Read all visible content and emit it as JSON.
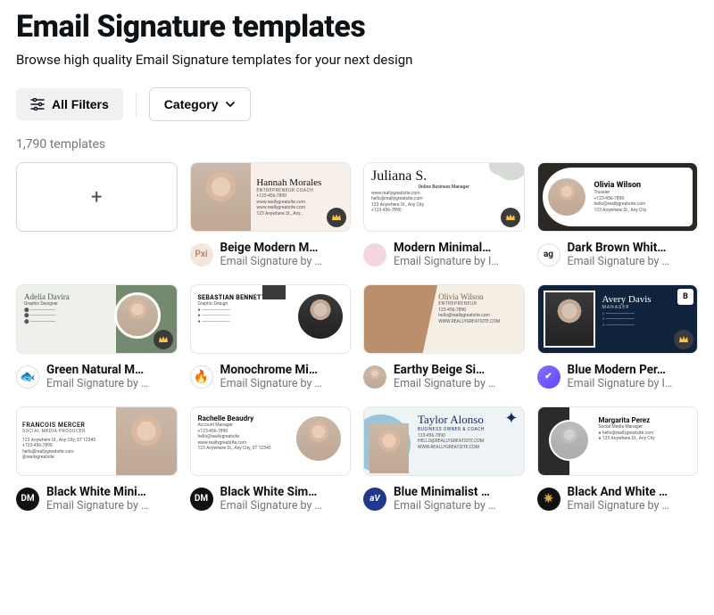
{
  "header": {
    "title": "Email Signature templates",
    "subtitle": "Browse high quality Email Signature templates for your next design"
  },
  "filters": {
    "all_label": "All Filters",
    "category_label": "Category"
  },
  "count_text": "1,790 templates",
  "create_blank_symbol": "+",
  "templates": [
    {
      "title": "Beige Modern M…",
      "author_line": "Email Signature by …",
      "avatar_bg": "#f4e6dc",
      "avatar_text": "Pxi",
      "avatar_fg": "#b38b6d",
      "premium": true
    },
    {
      "title": "Modern Minimal…",
      "author_line": "Email Signature by I…",
      "avatar_bg": "#f3d4df",
      "avatar_text": "",
      "avatar_fg": "#a85a7a",
      "premium": true
    },
    {
      "title": "Dark Brown Whit…",
      "author_line": "Email Signature by …",
      "avatar_bg": "#ffffff",
      "avatar_text": "ag",
      "avatar_fg": "#222",
      "premium": false
    },
    {
      "title": "Green Natural M…",
      "author_line": "Email Signature by …",
      "avatar_bg": "#ffffff",
      "avatar_text": "⬤",
      "avatar_fg": "#2d6a4f",
      "premium": true
    },
    {
      "title": "Monochrome Mi…",
      "author_line": "Email Signature by …",
      "avatar_bg": "#ffffff",
      "avatar_text": "🔥",
      "avatar_fg": "#e76f2a",
      "premium": false
    },
    {
      "title": "Earthy Beige Si…",
      "author_line": "Email Signature by …",
      "avatar_bg": "#e6d8c8",
      "avatar_text": "",
      "avatar_fg": "#8a6f54",
      "premium": false
    },
    {
      "title": "Blue Modern Per…",
      "author_line": "Email Signature by I…",
      "avatar_bg": "#6a5cff",
      "avatar_text": "✔",
      "avatar_fg": "#ffffff",
      "premium": true
    },
    {
      "title": "Black White Mini…",
      "author_line": "Email Signature by …",
      "avatar_bg": "#111111",
      "avatar_text": "DM",
      "avatar_fg": "#ffffff",
      "premium": false
    },
    {
      "title": "Black White Sim…",
      "author_line": "Email Signature by …",
      "avatar_bg": "#111111",
      "avatar_text": "DM",
      "avatar_fg": "#ffffff",
      "premium": false
    },
    {
      "title": "Blue Minimalist …",
      "author_line": "Email Signature by …",
      "avatar_bg": "#1f3a8a",
      "avatar_text": "aV",
      "avatar_fg": "#ffffff",
      "premium": false
    },
    {
      "title": "Black And White …",
      "author_line": "Email Signature by …",
      "avatar_bg": "#111111",
      "avatar_text": "✷",
      "avatar_fg": "#d4a94a",
      "premium": false
    }
  ],
  "thumbs": {
    "t0": {
      "name": "Hannah Morales",
      "role": "ENTREPRENEUR COACH",
      "line1": "+123-456-7890",
      "line2": "www.reallygreatsite.com",
      "line3": "www.reallygreatsite.com",
      "line4": "123 Anywhere St., Any…"
    },
    "t1": {
      "name": "Juliana S.",
      "role": "Online Business Manager",
      "line1": "www.reallygreatsite.com",
      "line2": "hello@reallygreatsite.com",
      "line3": "123 Anywhere St., Any City",
      "line4": "+123-456-7890"
    },
    "t2": {
      "name": "Olivia Wilson",
      "role": "Traveler",
      "line1": "+123-456-7890",
      "line2": "hello@reallygreatsite.com",
      "line3": "123 Anywhere St., Any City"
    },
    "t3": {
      "name": "Adelia Davira",
      "role": "Graphic Designer"
    },
    "t4": {
      "name": "SEBASTIAN BENNETT",
      "role": "Graphic Design"
    },
    "t5": {
      "name": "Olivia Wilson",
      "role": "ENTREPRENEUR",
      "line1": "123-456-7890",
      "line2": "hello@reallygreatsite.com",
      "line3": "WWW.REALLYGREATSITE.COM"
    },
    "t6": {
      "name": "Avery Davis",
      "role": "MANAGER"
    },
    "t7": {
      "name": "FRANCOIS MERCER",
      "role": "SOCIAL MEDIA PRODUCER",
      "line1": "123 Anywhere St., Any City, ST 12345",
      "line2": "+123-456-7890",
      "line3": "hello@reallygreatsite.com",
      "line4": "@reallygreatsite"
    },
    "t8": {
      "name": "Rachelle Beaudry",
      "role": "Account Manager",
      "line1": "+123-456-7890",
      "line2": "hello@reallygreatsite",
      "line3": "www.reallygreatsite.com",
      "line4": "123 Anywhere St., Any City, ST 12345"
    },
    "t9": {
      "name": "Taylor Alonso",
      "role": "BUSINESS OWNER & COACH",
      "line1": "123-456-7890",
      "line2": "HELLO@REALLYGREATSITE.COM",
      "line3": "WWW.REALLYGREATSITE.COM"
    },
    "t10": {
      "name": "Margarita Perez",
      "role": "Social Media Manager",
      "line1": "hello@reallygreatsite.com",
      "line2": "123 Anywhere St., Any City"
    }
  }
}
